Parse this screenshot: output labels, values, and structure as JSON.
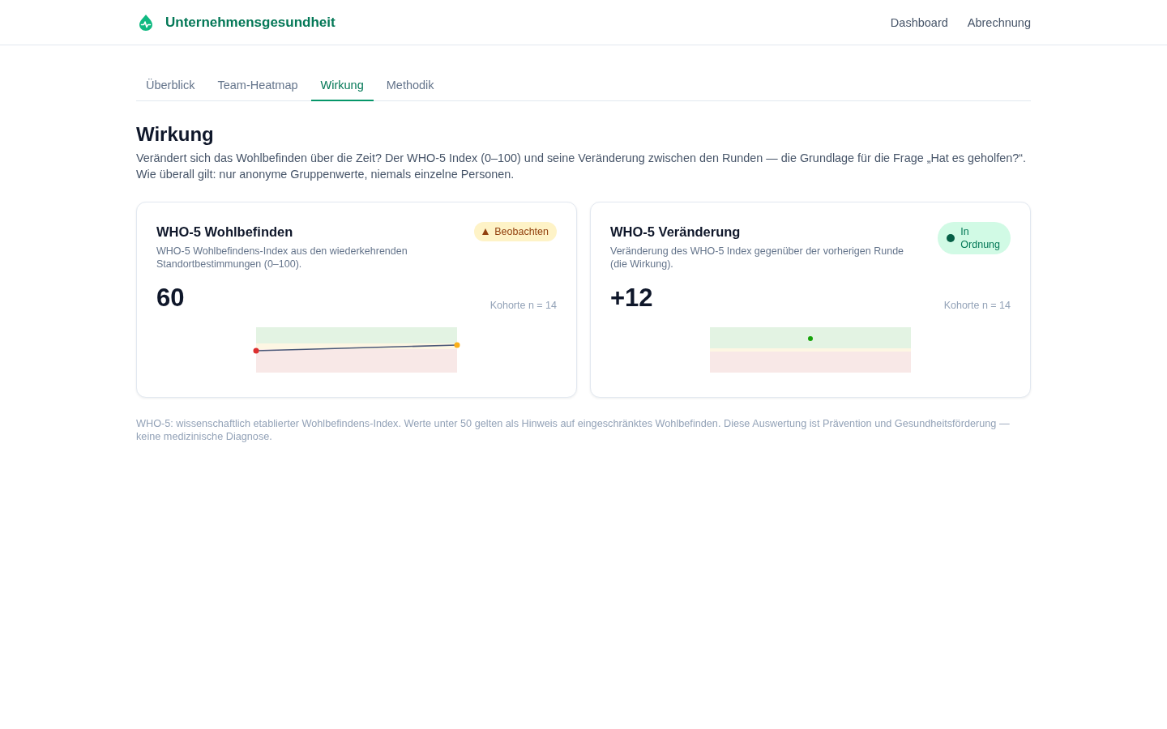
{
  "header": {
    "brand": "Unternehmensgesundheit",
    "nav": [
      {
        "label": "Dashboard"
      },
      {
        "label": "Abrechnung"
      }
    ]
  },
  "tabs": [
    {
      "label": "Überblick",
      "selected": false
    },
    {
      "label": "Team-Heatmap",
      "selected": false
    },
    {
      "label": "Wirkung",
      "selected": true
    },
    {
      "label": "Methodik",
      "selected": false
    }
  ],
  "section": {
    "title": "Wirkung",
    "intro": "Verändert sich das Wohlbefinden über die Zeit? Der WHO-5 Index (0–100) und seine Veränderung zwischen den Runden — die Grundlage für die Frage „Hat es geholfen?“. Wie überall gilt: nur anonyme Gruppenwerte, niemals einzelne Personen."
  },
  "cards": [
    {
      "kind": "trend",
      "title": "WHO-5 Wohlbefinden",
      "description": "WHO-5 Wohlbefindens-Index aus den wiederkehrenden Standortbestimmungen (0–100).",
      "badge": {
        "kind": "warning",
        "label": "Beobachten"
      },
      "value": "60",
      "cohort": "Kohorte n = 14"
    },
    {
      "kind": "change",
      "title": "WHO-5 Veränderung",
      "description": "Veränderung des WHO-5 Index gegenüber der vorherigen Runde (die Wirkung).",
      "badge": {
        "kind": "ok",
        "label": "In Ordnung"
      },
      "value": "+12",
      "cohort": "Kohorte n = 14"
    }
  ],
  "footnote": "WHO-5: wissenschaftlich etablierter Wohlbefindens-Index. Werte unter 50 gelten als Hinweis auf eingeschränktes Wohlbefinden. Diese Auswertung ist Prävention und Gesundheitsförderung — keine medizinische Diagnose."
}
